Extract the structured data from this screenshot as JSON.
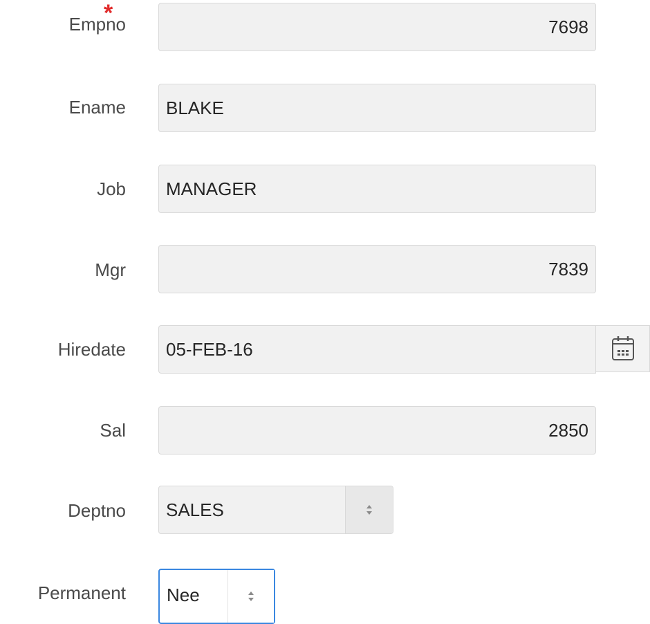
{
  "form": {
    "fields": {
      "empno": {
        "label": "Empno",
        "required_marker": "*",
        "value": "7698"
      },
      "ename": {
        "label": "Ename",
        "value": "BLAKE"
      },
      "job": {
        "label": "Job",
        "value": "MANAGER"
      },
      "mgr": {
        "label": "Mgr",
        "value": "7839"
      },
      "hiredate": {
        "label": "Hiredate",
        "value": "05-FEB-16",
        "icon": "calendar-icon"
      },
      "sal": {
        "label": "Sal",
        "value": "2850"
      },
      "deptno": {
        "label": "Deptno",
        "selected": "SALES",
        "icon": "select-arrows-icon"
      },
      "permanent": {
        "label": "Permanent",
        "selected": "Nee",
        "icon": "select-arrows-icon"
      }
    }
  },
  "colors": {
    "label_text": "#4a4a4a",
    "field_bg": "#f1f1f1",
    "field_border": "#d9d9d9",
    "required": "#e12b2b",
    "focus_border": "#3a87e0"
  }
}
